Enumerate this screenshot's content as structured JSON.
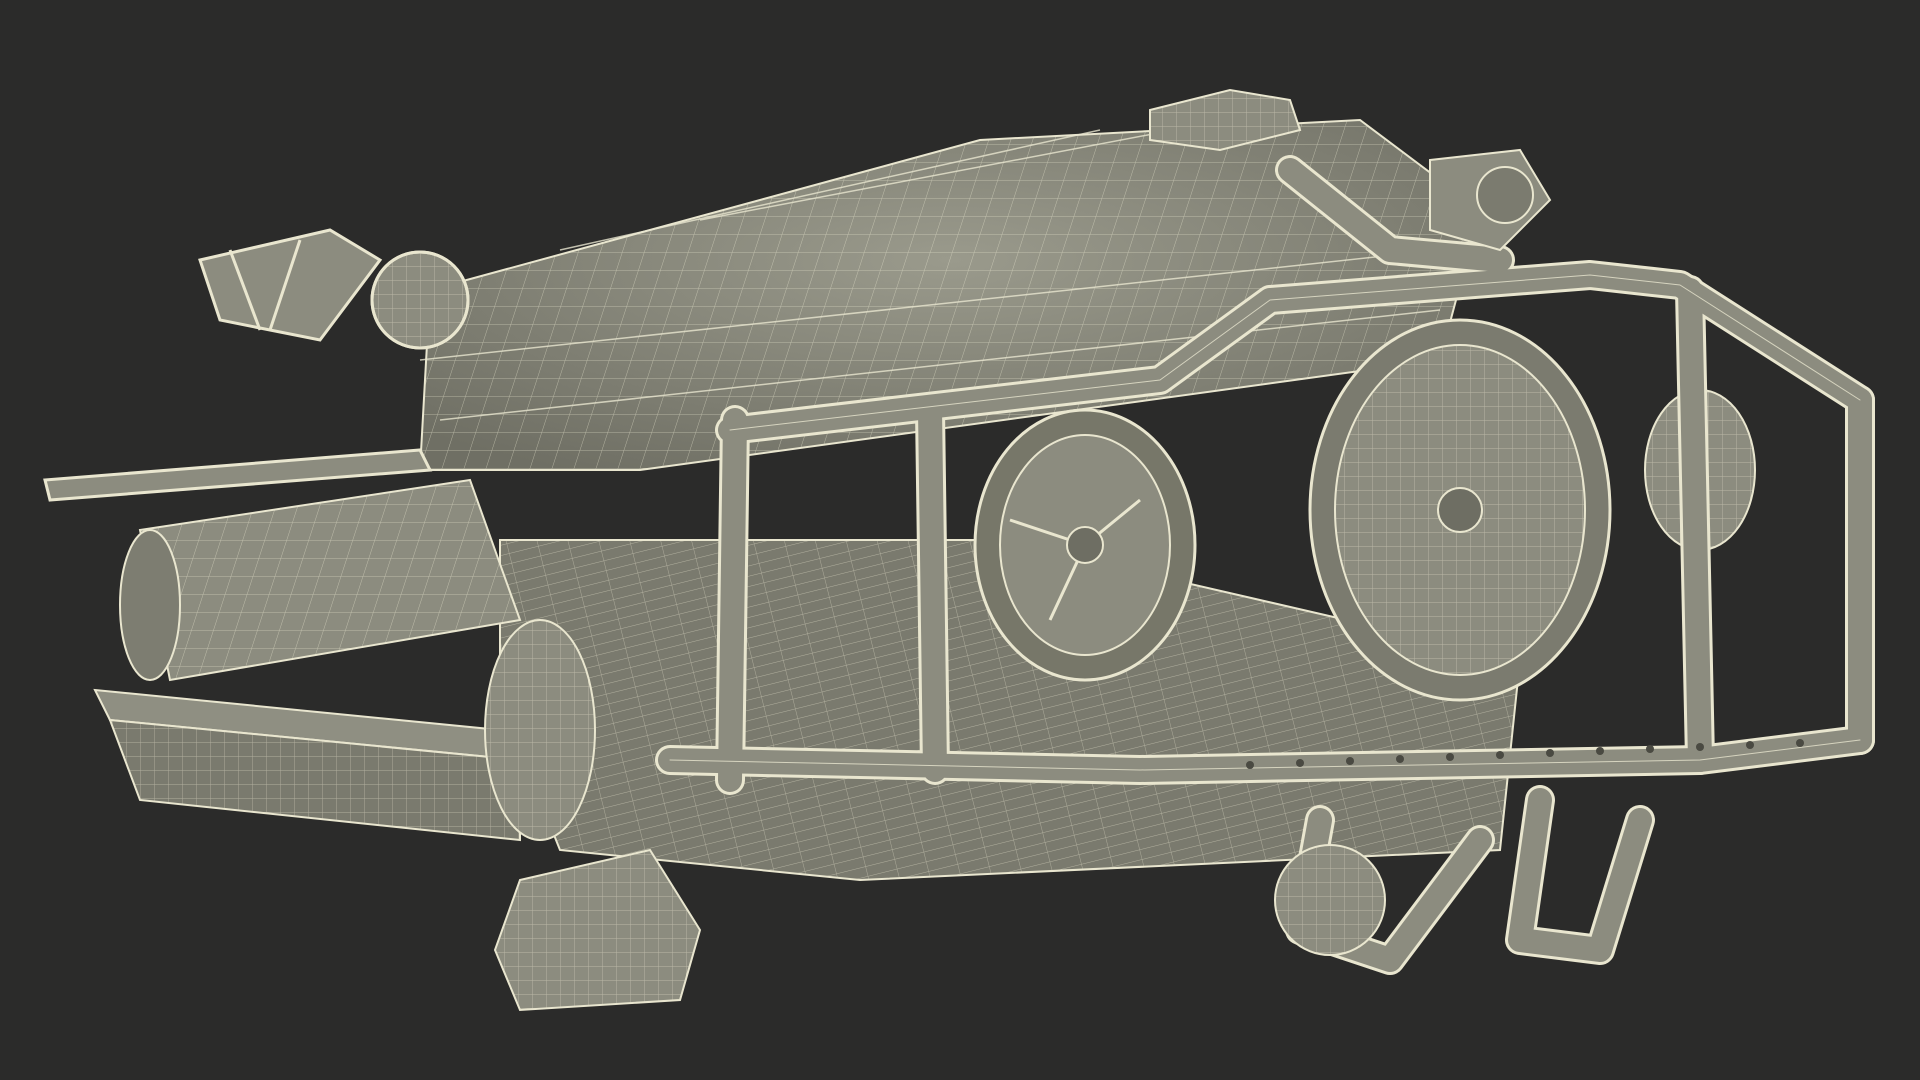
{
  "scene": {
    "background_color": "#2b2b2a",
    "fill_color": "#8c8c7f",
    "shadow_color": "#6e6e63",
    "highlight_color": "#a9a99b",
    "wire_color": "#e9e6cf",
    "subject": "wireframe-submersible-model"
  }
}
